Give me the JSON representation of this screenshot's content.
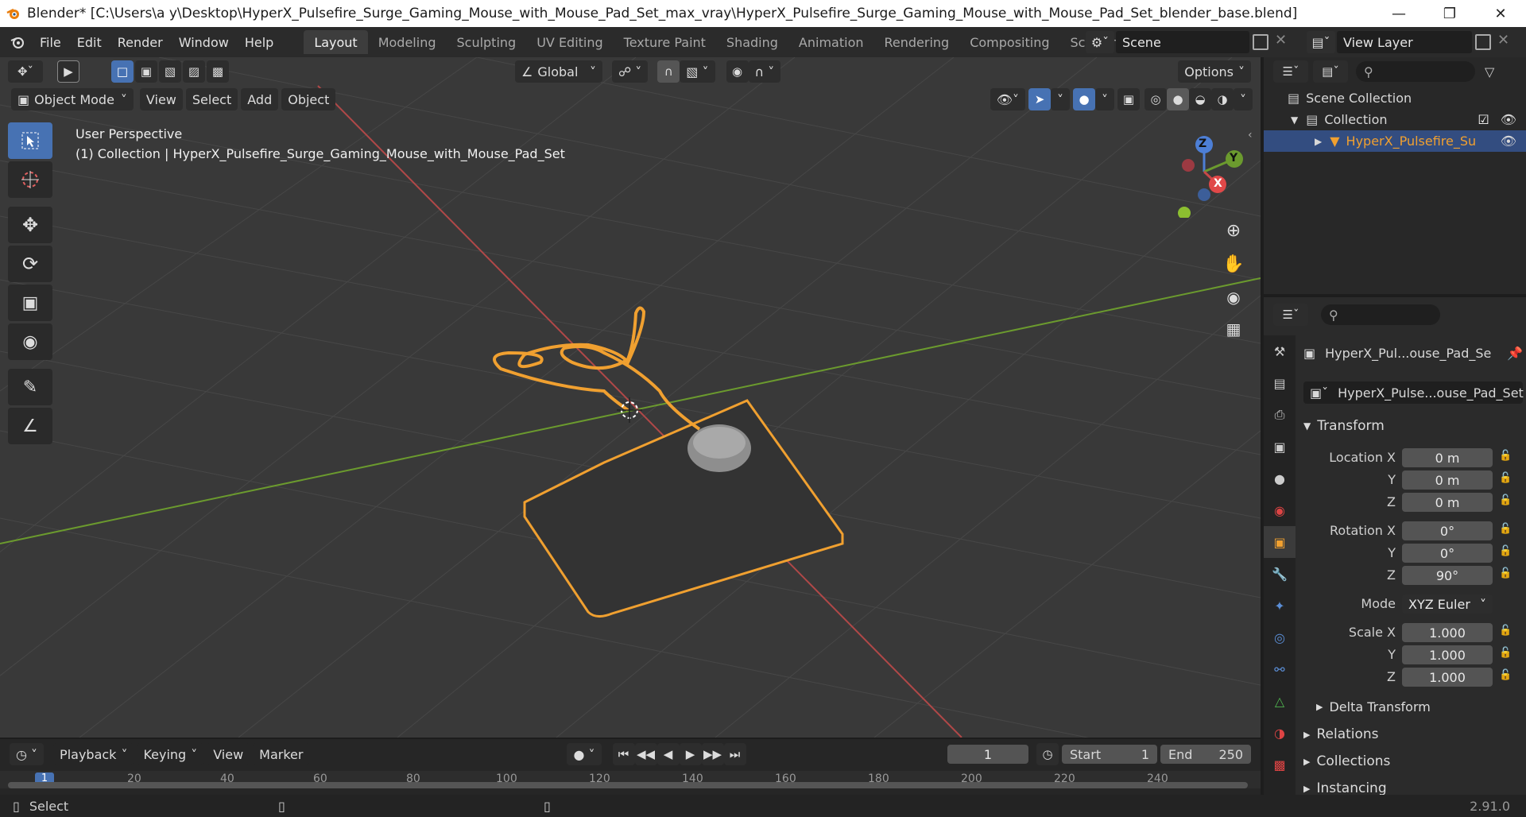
{
  "window": {
    "title": "Blender* [C:\\Users\\a y\\Desktop\\HyperX_Pulsefire_Surge_Gaming_Mouse_with_Mouse_Pad_Set_max_vray\\HyperX_Pulsefire_Surge_Gaming_Mouse_with_Mouse_Pad_Set_blender_base.blend]"
  },
  "menu": [
    "File",
    "Edit",
    "Render",
    "Window",
    "Help"
  ],
  "workspaces": [
    "Layout",
    "Modeling",
    "Sculpting",
    "UV Editing",
    "Texture Paint",
    "Shading",
    "Animation",
    "Rendering",
    "Compositing",
    "Scripting"
  ],
  "scene": {
    "name": "Scene",
    "view_layer": "View Layer"
  },
  "viewport": {
    "transform_orientation": "Global",
    "options_label": "Options",
    "mode": "Object Mode",
    "header_menus": [
      "View",
      "Select",
      "Add",
      "Object"
    ],
    "info_line1": "User Perspective",
    "info_line2": "(1) Collection | HyperX_Pulsefire_Surge_Gaming_Mouse_with_Mouse_Pad_Set",
    "gizmo": {
      "z": "Z",
      "y": "Y",
      "x": "X"
    }
  },
  "outliner": {
    "scene_collection": "Scene Collection",
    "collection": "Collection",
    "object": "HyperX_Pulsefire_Su"
  },
  "properties": {
    "object_name": "HyperX_Pul...ouse_Pad_Se",
    "data_name": "HyperX_Pulse...ouse_Pad_Set",
    "transform_label": "Transform",
    "location_label": "Location X",
    "rotation_label": "Rotation X",
    "scale_label": "Scale X",
    "y_label": "Y",
    "z_label": "Z",
    "location": [
      "0 m",
      "0 m",
      "0 m"
    ],
    "rotation": [
      "0°",
      "0°",
      "90°"
    ],
    "mode_label": "Mode",
    "mode_value": "XYZ Euler",
    "scale": [
      "1.000",
      "1.000",
      "1.000"
    ],
    "delta_transform": "Delta Transform",
    "relations": "Relations",
    "collections": "Collections",
    "instancing": "Instancing"
  },
  "timeline": {
    "menus": [
      "Playback",
      "Keying",
      "View",
      "Marker"
    ],
    "current_frame": "1",
    "start_label": "Start",
    "start_value": "1",
    "end_label": "End",
    "end_value": "250",
    "ticks": [
      "20",
      "40",
      "60",
      "80",
      "100",
      "120",
      "140",
      "160",
      "180",
      "200",
      "220",
      "240"
    ],
    "playhead": "1"
  },
  "status": {
    "left": "Select",
    "version": "2.91.0"
  },
  "colors": {
    "accent_blue": "#4772b3",
    "selection_orange": "#f0a030",
    "x_axis": "#b04848",
    "y_axis": "#6b9a2e"
  }
}
